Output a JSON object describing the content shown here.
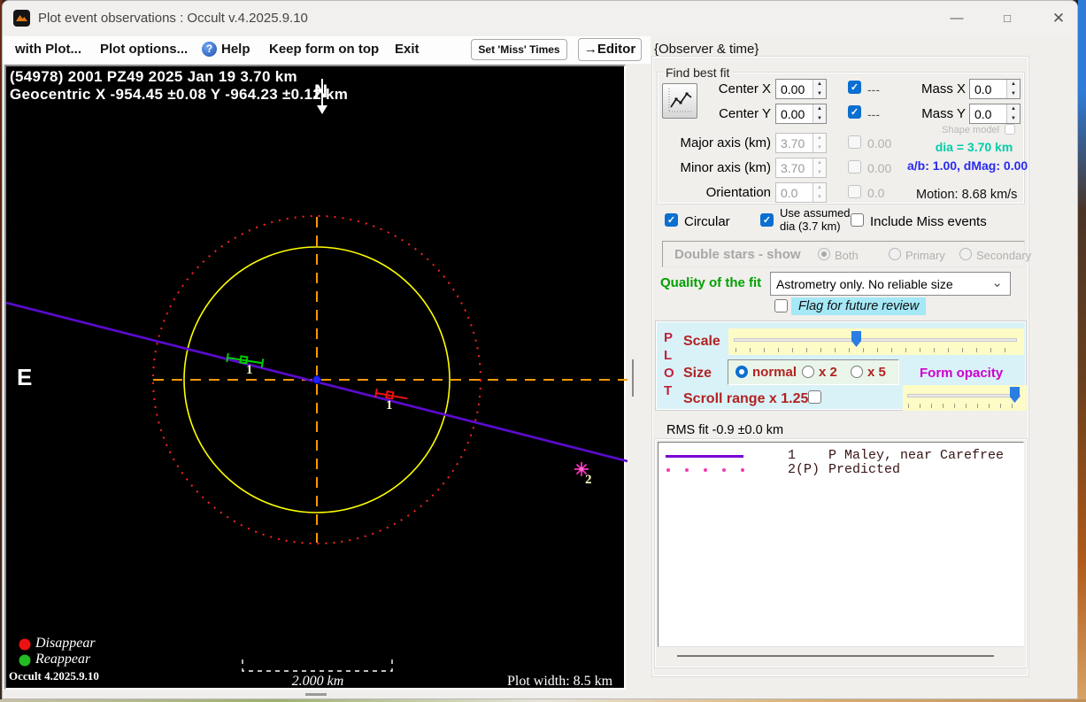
{
  "window": {
    "title": "Plot event observations : Occult v.4.2025.9.10"
  },
  "menubar": {
    "items": [
      {
        "label": "with Plot..."
      },
      {
        "label": "Plot options..."
      },
      {
        "label": "Help"
      },
      {
        "label": "Keep form on top"
      },
      {
        "label": "Exit"
      }
    ],
    "set_miss_times_button": "Set 'Miss' Times",
    "editor_button": "→Editor",
    "observer_time_label": "{Observer & time}"
  },
  "plot": {
    "header_line1": "(54978) 2001 PZ49  2025 Jan 19   3.70 km",
    "header_line2": "Geocentric X -954.45 ±0.08 Y -964.23 ±0.12 km",
    "north_label": "N",
    "east_label": "E",
    "marker_green_label": "1",
    "marker_red_label": "1",
    "marker_star_label": "2",
    "legend_disappear": "Disappear",
    "legend_reappear": "Reappear",
    "version_label": "Occult 4.2025.9.10",
    "scale_bar_label": "2.000 km",
    "plot_width_label": "Plot width: 8.5 km"
  },
  "fit": {
    "group_label": "Find best fit",
    "center_x_label": "Center X",
    "center_x_value": "0.00",
    "center_x_tag": "---",
    "center_y_label": "Center Y",
    "center_y_value": "0.00",
    "center_y_tag": "---",
    "mass_x_label": "Mass X",
    "mass_x_value": "0.0",
    "mass_y_label": "Mass Y",
    "mass_y_value": "0.0",
    "shape_model_label": "Shape model",
    "major_axis_label": "Major axis (km)",
    "major_axis_value": "3.70",
    "major_axis_tag": "0.00",
    "minor_axis_label": "Minor axis (km)",
    "minor_axis_value": "3.70",
    "minor_axis_tag": "0.00",
    "orientation_label": "Orientation",
    "orientation_value": "0.0",
    "orientation_tag": "0.0",
    "dia_label": "dia = 3.70 km",
    "ab_dmag_label": "a/b: 1.00, dMag: 0.00",
    "motion_label": "Motion: 8.68 km/s",
    "circular_label": "Circular",
    "use_assumed_line1": "Use assumed",
    "use_assumed_line2": "dia (3.7 km)",
    "include_miss_label": "Include Miss events"
  },
  "double_stars": {
    "label": "Double stars - show",
    "options": [
      "Both",
      "Primary",
      "Secondary"
    ],
    "selected": "Both"
  },
  "quality": {
    "label": "Quality of the fit",
    "value": "Astrometry only. No reliable size",
    "flag_label": "Flag for future review"
  },
  "plot_controls": {
    "panel_letters": [
      "P",
      "L",
      "O",
      "T"
    ],
    "scale_label": "Scale",
    "size_label": "Size",
    "size_options": [
      "normal",
      "x 2",
      "x 5"
    ],
    "size_selected": "normal",
    "form_opacity_label": "Form opacity",
    "scroll_range_label": "Scroll range x 1.25"
  },
  "observations": {
    "rms_label": "RMS fit -0.9 ±0.0 km",
    "rows": [
      {
        "id": "1",
        "name": "P Maley, near Carefree"
      },
      {
        "id": "2(P)",
        "name": "Predicted"
      }
    ]
  },
  "colors": {
    "accent_blue": "#0b6fd0",
    "quality_green": "#00a000",
    "dia_teal": "#00ccaa",
    "ab_blue": "#2a2af0",
    "plot_label_red": "#b22222",
    "form_opacity_magenta": "#cc00cc",
    "track_line_purple": "#7a00d4",
    "predicted_dot_magenta": "#f03cb4"
  }
}
